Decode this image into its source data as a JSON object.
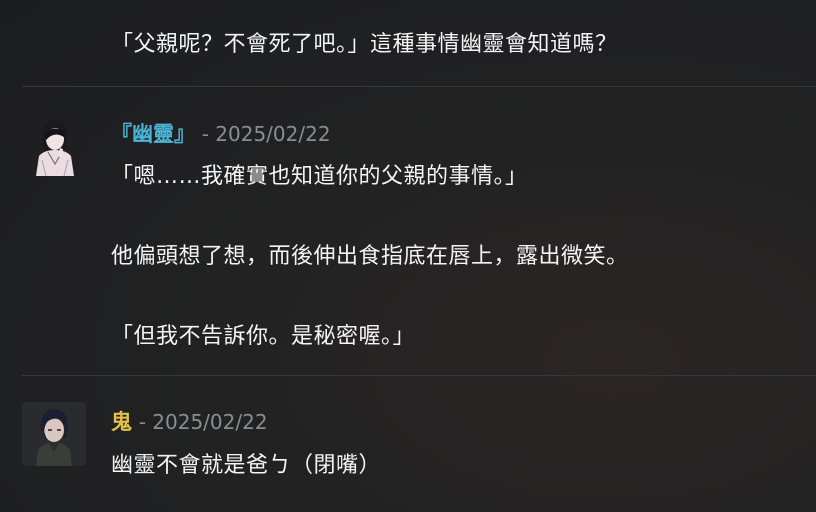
{
  "messages": [
    {
      "continued_line": "「父親呢？不會死了吧。」這種事情幽靈會知道嗎？"
    },
    {
      "author": "『幽靈』",
      "author_color": "#4ab3d6",
      "date_sep": "- ",
      "date": "2025/02/22",
      "avatar_icon": "ghost-character-avatar",
      "lines": [
        "「嗯……我確實也知道你的父親的事情。」",
        "他偏頭想了想，而後伸出食指底在唇上，露出微笑。",
        "「但我不告訴你。是秘密喔。」"
      ]
    },
    {
      "author": "鬼",
      "author_color": "#e3c04d",
      "date_sep": "- ",
      "date": "2025/02/22",
      "avatar_icon": "oni-character-avatar",
      "lines": [
        "幽靈不會就是爸ㄅ（閉嘴）"
      ]
    }
  ]
}
